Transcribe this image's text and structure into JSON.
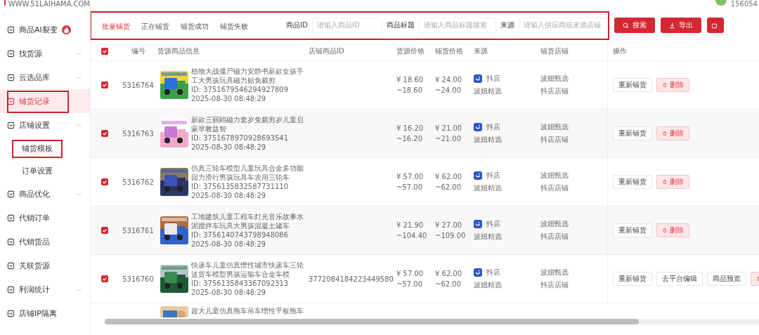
{
  "header": {
    "site_url": "WWW.51LAIHAMA.COM",
    "user_id": "156054"
  },
  "sidebar": {
    "items": [
      {
        "label": "商品AI裂变",
        "kind": "link",
        "selected": false,
        "highlighted": false,
        "badge": true
      },
      {
        "label": "找货源",
        "kind": "group",
        "expanded": false,
        "selected": false,
        "highlighted": false
      },
      {
        "label": "云选品库",
        "kind": "group",
        "expanded": false,
        "selected": false,
        "highlighted": false
      },
      {
        "label": "铺货记录",
        "kind": "link",
        "selected": true,
        "highlighted": true
      },
      {
        "label": "店铺设置",
        "kind": "group",
        "expanded": true,
        "selected": false,
        "highlighted": false,
        "children": [
          {
            "label": "铺货模板",
            "selected": false,
            "highlighted": true
          },
          {
            "label": "订单设置",
            "selected": false,
            "highlighted": false
          }
        ]
      },
      {
        "label": "商品优化",
        "kind": "group",
        "expanded": false,
        "selected": false,
        "highlighted": false
      },
      {
        "label": "代销订单",
        "kind": "link",
        "selected": false,
        "highlighted": false
      },
      {
        "label": "代销货品",
        "kind": "link",
        "selected": false,
        "highlighted": false
      },
      {
        "label": "关联货源",
        "kind": "link",
        "selected": false,
        "highlighted": false
      },
      {
        "label": "利润统计",
        "kind": "group",
        "expanded": false,
        "selected": false,
        "highlighted": false
      },
      {
        "label": "店铺IP隔离",
        "kind": "link",
        "selected": false,
        "highlighted": false
      }
    ]
  },
  "filter_bar": {
    "highlighted": true,
    "tabs": [
      {
        "label": "批量铺货",
        "selected": true
      },
      {
        "label": "正在铺货",
        "selected": false
      },
      {
        "label": "铺货成功",
        "selected": false
      },
      {
        "label": "铺货失败",
        "selected": false
      }
    ],
    "fields": [
      {
        "label": "商品ID",
        "placeholder": "请输入商品ID"
      },
      {
        "label": "商品标题",
        "placeholder": "请输入商品标题搜索"
      },
      {
        "label": "来源",
        "placeholder": "请输入供应商或来源店铺"
      }
    ],
    "buttons": [
      {
        "label": "搜索",
        "kind": "search"
      },
      {
        "label": "导出",
        "kind": "export"
      },
      {
        "kind": "more"
      }
    ]
  },
  "table": {
    "all_checked": true,
    "columns": [
      "编号",
      "货源商品信息",
      "店铺商品ID",
      "货源价格",
      "铺货价格",
      "来源",
      "铺货店铺",
      "操作"
    ],
    "rows": [
      {
        "checked": true,
        "number": "5316764",
        "title": "植物大战僵尸磁力安静书新款女孩手工大男孩玩具磁力贴免裁剪",
        "product_id": "ID: 3751679546294927809",
        "time": "2025-08-30 08:48:29",
        "source_price": "¥ 18.60",
        "source_price_range": "~18.60",
        "list_price": "¥ 24.00",
        "list_price_range": "~24.00",
        "platform": "抖店",
        "supplier": "波妞精选",
        "store_name": "波妞甄选",
        "store_type": "抖店店铺",
        "actions": [
          {
            "kind": "relist",
            "label": "重新铺货"
          },
          {
            "kind": "delete",
            "label": "删除"
          }
        ]
      },
      {
        "checked": true,
        "number": "5316763",
        "title": "新款三丽鸥磁力套岁免裁剪岁儿童启蒙早教益智",
        "product_id": "ID: 3751678970928693541",
        "time": "2025-08-30 08:48:29",
        "source_price": "¥ 16.20",
        "source_price_range": "~16.20",
        "list_price": "¥ 21.00",
        "list_price_range": "~21.00",
        "platform": "抖店",
        "supplier": "波妞精选",
        "store_name": "波妞甄选",
        "store_type": "抖店店铺",
        "actions": [
          {
            "kind": "relist",
            "label": "重新铺货"
          },
          {
            "kind": "delete",
            "label": "删除"
          }
        ]
      },
      {
        "checked": true,
        "number": "5316762",
        "title": "仿真三轮车模型儿童玩具合金多功能回力滑行男孩玩具车农用三轮车",
        "product_id": "ID: 3756135832587731110",
        "time": "2025-08-30 08:48:29",
        "source_price": "¥ 57.00",
        "source_price_range": "~57.00",
        "list_price": "¥ 62.00",
        "list_price_range": "~62.00",
        "platform": "抖店",
        "supplier": "波妞精选",
        "store_name": "波妞甄选",
        "store_type": "抖店店铺",
        "actions": [
          {
            "kind": "relist",
            "label": "重新铺货"
          },
          {
            "kind": "delete",
            "label": "删除"
          }
        ]
      },
      {
        "checked": true,
        "number": "5316761",
        "title": "工地建筑儿童工程车灯光音乐故事水泥搅拌车玩具大男孩混凝土罐车",
        "product_id": "ID: 3756140743798948086",
        "time": "2025-08-30 08:48:29",
        "source_price": "¥ 21.90",
        "source_price_range": "~104.40",
        "list_price": "¥ 27.00",
        "list_price_range": "~109.00",
        "platform": "抖店",
        "supplier": "波妞精选",
        "store_name": "波妞甄选",
        "store_type": "抖店店铺",
        "actions": [
          {
            "kind": "relist",
            "label": "重新铺货"
          },
          {
            "kind": "delete",
            "label": "删除"
          }
        ]
      },
      {
        "checked": true,
        "number": "5316760",
        "title": "快递车儿童仿真惯性城市快递车三轮送货车模型男孩运输车合金车模",
        "product_id": "ID: 3756135843367092313",
        "time": "2025-08-30 08:48:29",
        "store_product_id": "3772084184223449580",
        "source_price": "¥ 57.00",
        "source_price_range": "~57.00",
        "list_price": "¥ 62.00",
        "list_price_range": "~62.00",
        "platform": "抖店",
        "supplier": "波妞精选",
        "store_name": "波妞甄选",
        "store_type": "抖店店铺",
        "actions": [
          {
            "kind": "relist",
            "label": "重新铺货"
          },
          {
            "kind": "edit",
            "label": "去平台编辑"
          },
          {
            "kind": "preview",
            "label": "商品预览"
          },
          {
            "kind": "delete"
          }
        ]
      }
    ],
    "partial_row": {
      "title": "超大儿童仿真拖车吊车惯性平板拖车"
    }
  }
}
